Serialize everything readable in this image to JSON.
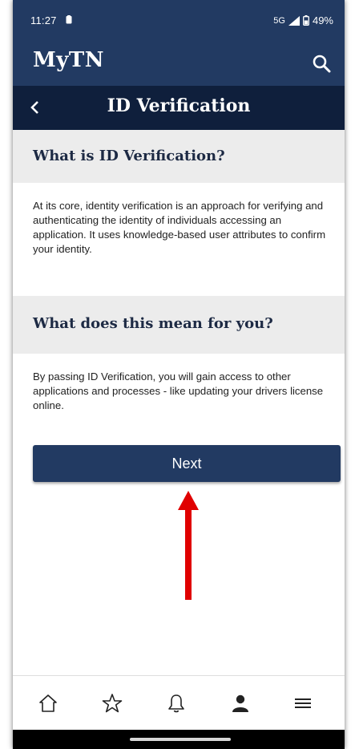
{
  "status_bar": {
    "time": "11:27",
    "network": "5G",
    "battery": "49%"
  },
  "header": {
    "brand": "MyTN"
  },
  "title_bar": {
    "title": "ID Verification"
  },
  "sections": [
    {
      "heading": "What is ID Verification?",
      "body": "At its core, identity verification is an approach for verifying and authenticating the identity of individuals accessing an application. It uses knowledge-based user attributes to confirm your identity."
    },
    {
      "heading": "What does this mean for you?",
      "body": "By passing ID Verification, you will gain access to other applications and processes - like updating your drivers license online."
    }
  ],
  "primary_action": {
    "label": "Next"
  },
  "bottom_nav": [
    "home-icon",
    "favorites-star-icon",
    "notifications-bell-icon",
    "profile-icon",
    "menu-icon"
  ],
  "colors": {
    "brand_navy": "#223a62",
    "title_bar_navy": "#0f1f3c",
    "annotation_arrow": "#e00000"
  }
}
